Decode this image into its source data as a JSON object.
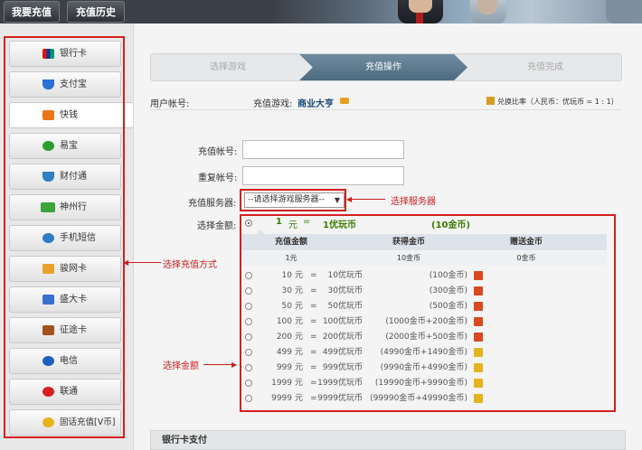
{
  "top_tabs": [
    "我要充值",
    "充值历史"
  ],
  "sidebar": {
    "items": [
      "银行卡",
      "支付宝",
      "快钱",
      "易宝",
      "财付通",
      "神州行",
      "手机短信",
      "骏网卡",
      "盛大卡",
      "征途卡",
      "电信",
      "联通",
      "固话充值[V币]"
    ]
  },
  "steps": [
    "选择游戏",
    "充值操作",
    "充值完成"
  ],
  "info": {
    "user_label": "用户帐号:",
    "game_label": "充值游戏:",
    "game_name": "商业大亨",
    "rate": "兑换比率（人民币：优玩币 = 1 : 1）"
  },
  "form": {
    "account_label": "充值帐号:",
    "repeat_label": "重复帐号:",
    "server_label": "充值服务器:",
    "server_value": "--请选择游戏服务器--",
    "amount_label": "选择金额:"
  },
  "selected_amount": {
    "qty": "1",
    "unit": "元",
    "eq": "=",
    "coins": "1优玩币",
    "gold": "(10金币)"
  },
  "table": {
    "headers": [
      "充值金额",
      "获得金币",
      "赠送金币"
    ],
    "sub": [
      "1元",
      "10金币",
      "0金币"
    ],
    "rows": [
      {
        "amt": "10",
        "coins": "10优玩币",
        "gold": "(100金币)"
      },
      {
        "amt": "30",
        "coins": "30优玩币",
        "gold": "(300金币)"
      },
      {
        "amt": "50",
        "coins": "50优玩币",
        "gold": "(500金币)"
      },
      {
        "amt": "100",
        "coins": "100优玩币",
        "gold": "(1000金币+200金币)"
      },
      {
        "amt": "200",
        "coins": "200优玩币",
        "gold": "(2000金币+500金币)"
      },
      {
        "amt": "499",
        "coins": "499优玩币",
        "gold": "(4990金币+1490金币)"
      },
      {
        "amt": "999",
        "coins": "999优玩币",
        "gold": "(9990金币+4990金币)"
      },
      {
        "amt": "1999",
        "coins": "1999优玩币",
        "gold": "(19990金币+9990金币)"
      },
      {
        "amt": "9999",
        "coins": "9999优玩币",
        "gold": "(99990金币+49990金币)"
      }
    ]
  },
  "row_unit": "元",
  "row_eq": "=",
  "annotations": {
    "server": "选择服务器",
    "method": "选择充值方式",
    "amount": "选择金额"
  },
  "bottom_title": "银行卡支付",
  "colors": {
    "annotation": "#c82020",
    "accent_green": "#3a7d00",
    "step_active": "#5a7689"
  }
}
